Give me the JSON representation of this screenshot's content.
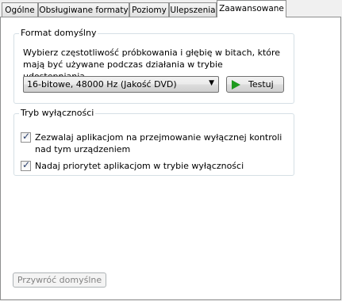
{
  "tabs": [
    {
      "label": "Ogólne"
    },
    {
      "label": "Obsługiwane formaty"
    },
    {
      "label": "Poziomy"
    },
    {
      "label": "Ulepszenia"
    },
    {
      "label": "Zaawansowane"
    }
  ],
  "active_tab": "Zaawansowane",
  "default_format": {
    "title": "Format domyślny",
    "description": "Wybierz częstotliwość próbkowania i głębię w bitach, które mają być używane podczas działania w trybie udostępniania.",
    "selected_value": "16-bitowe, 48000 Hz (Jakość DVD)",
    "test_button_label": "Testuj"
  },
  "exclusive_mode": {
    "title": "Tryb wyłączności",
    "options": [
      {
        "label": "Zezwalaj aplikacjom na przejmowanie wyłącznej kontroli nad tym urządzeniem",
        "checked": true
      },
      {
        "label": "Nadaj priorytet aplikacjom w trybie wyłączności",
        "checked": true
      }
    ]
  },
  "restore_defaults_label": "Przywróć domyślne",
  "icons": {
    "dropdown": "chevron-down-icon",
    "test": "play-icon",
    "check": "checkmark-icon"
  },
  "colors": {
    "play_icon": "#1e9a1e",
    "group_border": "#d5dfe5",
    "disabled_text": "#838383"
  }
}
